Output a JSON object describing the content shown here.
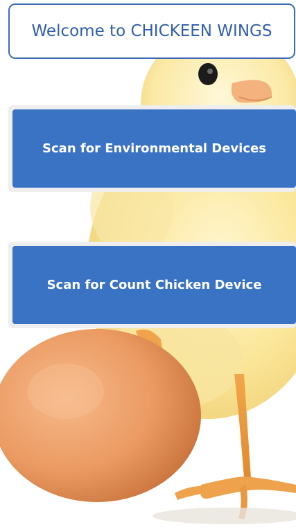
{
  "header": {
    "welcome_text": "Welcome to CHICKEEN WINGS"
  },
  "actions": {
    "scan_environmental_label": "Scan for Environmental Devices",
    "scan_count_chicken_label": "Scan for Count Chicken Device"
  },
  "colors": {
    "primary_button": "#3a72c4",
    "welcome_border": "#3e6bb8",
    "welcome_text": "#2f5fad",
    "button_frame": "#eeeeee"
  },
  "background": {
    "image_subject": "chick-with-egg-photo"
  }
}
